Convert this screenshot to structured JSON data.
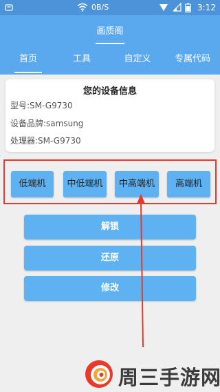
{
  "status_bar": {
    "network_speed": "0B/S",
    "time": "3:12",
    "icons": [
      "notification-icon",
      "wifi-icon",
      "signal-icon",
      "battery-icon"
    ]
  },
  "app": {
    "title": "画质阁"
  },
  "tabs": [
    {
      "label": "首页",
      "active": true
    },
    {
      "label": "工具",
      "active": false
    },
    {
      "label": "自定义",
      "active": false
    },
    {
      "label": "专属代码",
      "active": false
    }
  ],
  "device_info": {
    "title": "您的设备信息",
    "model": "型号:SM-G9730",
    "brand": "设备品牌:samsung",
    "processor": "处理器:SM-G9730"
  },
  "tiers": {
    "low": "低端机",
    "mid_low": "中低端机",
    "mid_high": "中高端机",
    "high": "高端机"
  },
  "actions": {
    "unlock": "解锁",
    "restore": "还原",
    "modify": "修改"
  },
  "watermark": {
    "text": "周三手游网"
  },
  "colors": {
    "primary": "#5aa8ee",
    "status_bar": "#4d93d9",
    "button": "#5fb2f2",
    "highlight": "#e23a2c"
  }
}
